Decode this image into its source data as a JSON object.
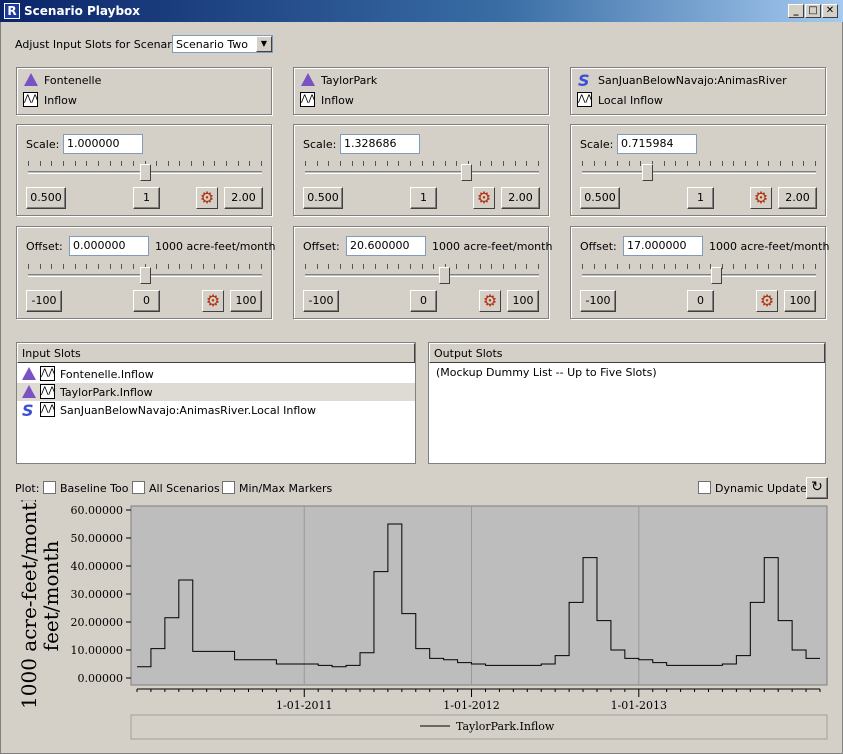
{
  "window": {
    "title": "Scenario Playbox"
  },
  "scenario": {
    "label": "Adjust Input Slots for Scenario:",
    "selected": "Scenario Two"
  },
  "columns": [
    {
      "object": "Fontenelle",
      "object_icon": "reservoir-icon",
      "slot": "Inflow",
      "scale": {
        "label": "Scale:",
        "value": "1.000000",
        "min_label": "0.500",
        "mid_label": "1",
        "max_label": "2.00",
        "level": 0.5
      },
      "offset": {
        "label": "Offset:",
        "value": "0.000000",
        "unit": "1000 acre-feet/month",
        "min_label": "-100",
        "mid_label": "0",
        "max_label": "100",
        "level": 0.5
      }
    },
    {
      "object": "TaylorPark",
      "object_icon": "reservoir-icon",
      "slot": "Inflow",
      "scale": {
        "label": "Scale:",
        "value": "1.328686",
        "min_label": "0.500",
        "mid_label": "1",
        "max_label": "2.00",
        "level": 0.7
      },
      "offset": {
        "label": "Offset:",
        "value": "20.600000",
        "unit": "1000 acre-feet/month",
        "min_label": "-100",
        "mid_label": "0",
        "max_label": "100",
        "level": 0.6
      }
    },
    {
      "object": "SanJuanBelowNavajo:AnimasRiver",
      "object_icon": "river-reach-icon",
      "slot": "Local Inflow",
      "scale": {
        "label": "Scale:",
        "value": "0.715984",
        "min_label": "0.500",
        "mid_label": "1",
        "max_label": "2.00",
        "level": 0.27
      },
      "offset": {
        "label": "Offset:",
        "value": "17.000000",
        "unit": "1000 acre-feet/month",
        "min_label": "-100",
        "mid_label": "0",
        "max_label": "100",
        "level": 0.58
      }
    }
  ],
  "input_slots": {
    "header": "Input Slots",
    "items": [
      {
        "label": "Fontenelle.Inflow",
        "icon": "reservoir-icon",
        "selected": false
      },
      {
        "label": "TaylorPark.Inflow",
        "icon": "reservoir-icon",
        "selected": true
      },
      {
        "label": "SanJuanBelowNavajo:AnimasRiver.Local Inflow",
        "icon": "river-reach-icon",
        "selected": false
      }
    ]
  },
  "output_slots": {
    "header": "Output Slots",
    "placeholder": "(Mockup Dummy List -- Up to Five Slots)"
  },
  "plot_options": {
    "label": "Plot:",
    "baseline": "Baseline Too",
    "all_scenarios": "All Scenarios",
    "minmax": "Min/Max Markers",
    "dynamic": "Dynamic Update"
  },
  "chart_data": {
    "type": "line",
    "step": true,
    "ylabel": "1000 acre-feet/month",
    "ylim": [
      0,
      60
    ],
    "yticks": [
      "0.00000",
      "10.00000",
      "20.00000",
      "30.00000",
      "40.00000",
      "50.00000",
      "60.00000"
    ],
    "xticks": [
      {
        "label": "1-01-2011",
        "month": 12
      },
      {
        "label": "1-01-2012",
        "month": 24
      },
      {
        "label": "1-01-2013",
        "month": 36
      }
    ],
    "legend": "TaylorPark.Inflow",
    "series": [
      {
        "name": "TaylorPark.Inflow",
        "start_month": 0,
        "values": [
          4,
          10.5,
          21.5,
          35,
          9.5,
          9.5,
          9.5,
          6.5,
          6.5,
          6.5,
          5,
          5,
          5,
          4.5,
          4,
          4.5,
          9,
          38,
          55,
          23,
          10.5,
          7,
          6.5,
          5.5,
          5,
          4.5,
          4.5,
          4.5,
          4.5,
          5,
          8,
          27,
          43,
          20.5,
          10,
          7,
          6.5,
          5.5,
          4.5,
          4.5,
          4.5,
          4.5,
          5,
          8,
          27,
          43,
          20.5,
          10,
          7
        ]
      }
    ]
  }
}
